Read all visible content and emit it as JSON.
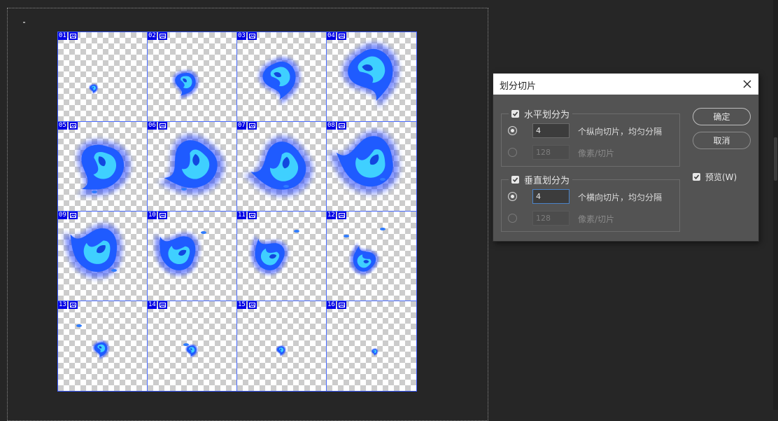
{
  "canvas": {
    "slices": [
      "01",
      "02",
      "03",
      "04",
      "05",
      "06",
      "07",
      "08",
      "09",
      "10",
      "11",
      "12",
      "13",
      "14",
      "15",
      "16"
    ]
  },
  "dialog": {
    "title": "划分切片",
    "horizontal": {
      "checkbox_label": "水平划分为",
      "checked": true,
      "count_value": "4",
      "count_suffix": "个纵向切片，均匀分隔",
      "pixels_value": "128",
      "pixels_suffix": "像素/切片"
    },
    "vertical": {
      "checkbox_label": "垂直划分为",
      "checked": true,
      "count_value": "4",
      "count_suffix": "个横向切片，均匀分隔",
      "pixels_value": "128",
      "pixels_suffix": "像素/切片"
    },
    "ok_label": "确定",
    "cancel_label": "取消",
    "preview_label": "预览(W)",
    "preview_checked": true
  },
  "colors": {
    "slice_badge": "#0000e6",
    "slice_line": "#4b6dff",
    "focus_border": "#4b83c8",
    "flame_core": "#3fd0ff",
    "flame_glow": "#1a3cff"
  },
  "icons": [
    "close-icon",
    "checkbox-checked-icon",
    "slice-image-icon",
    "flame-sprite"
  ]
}
